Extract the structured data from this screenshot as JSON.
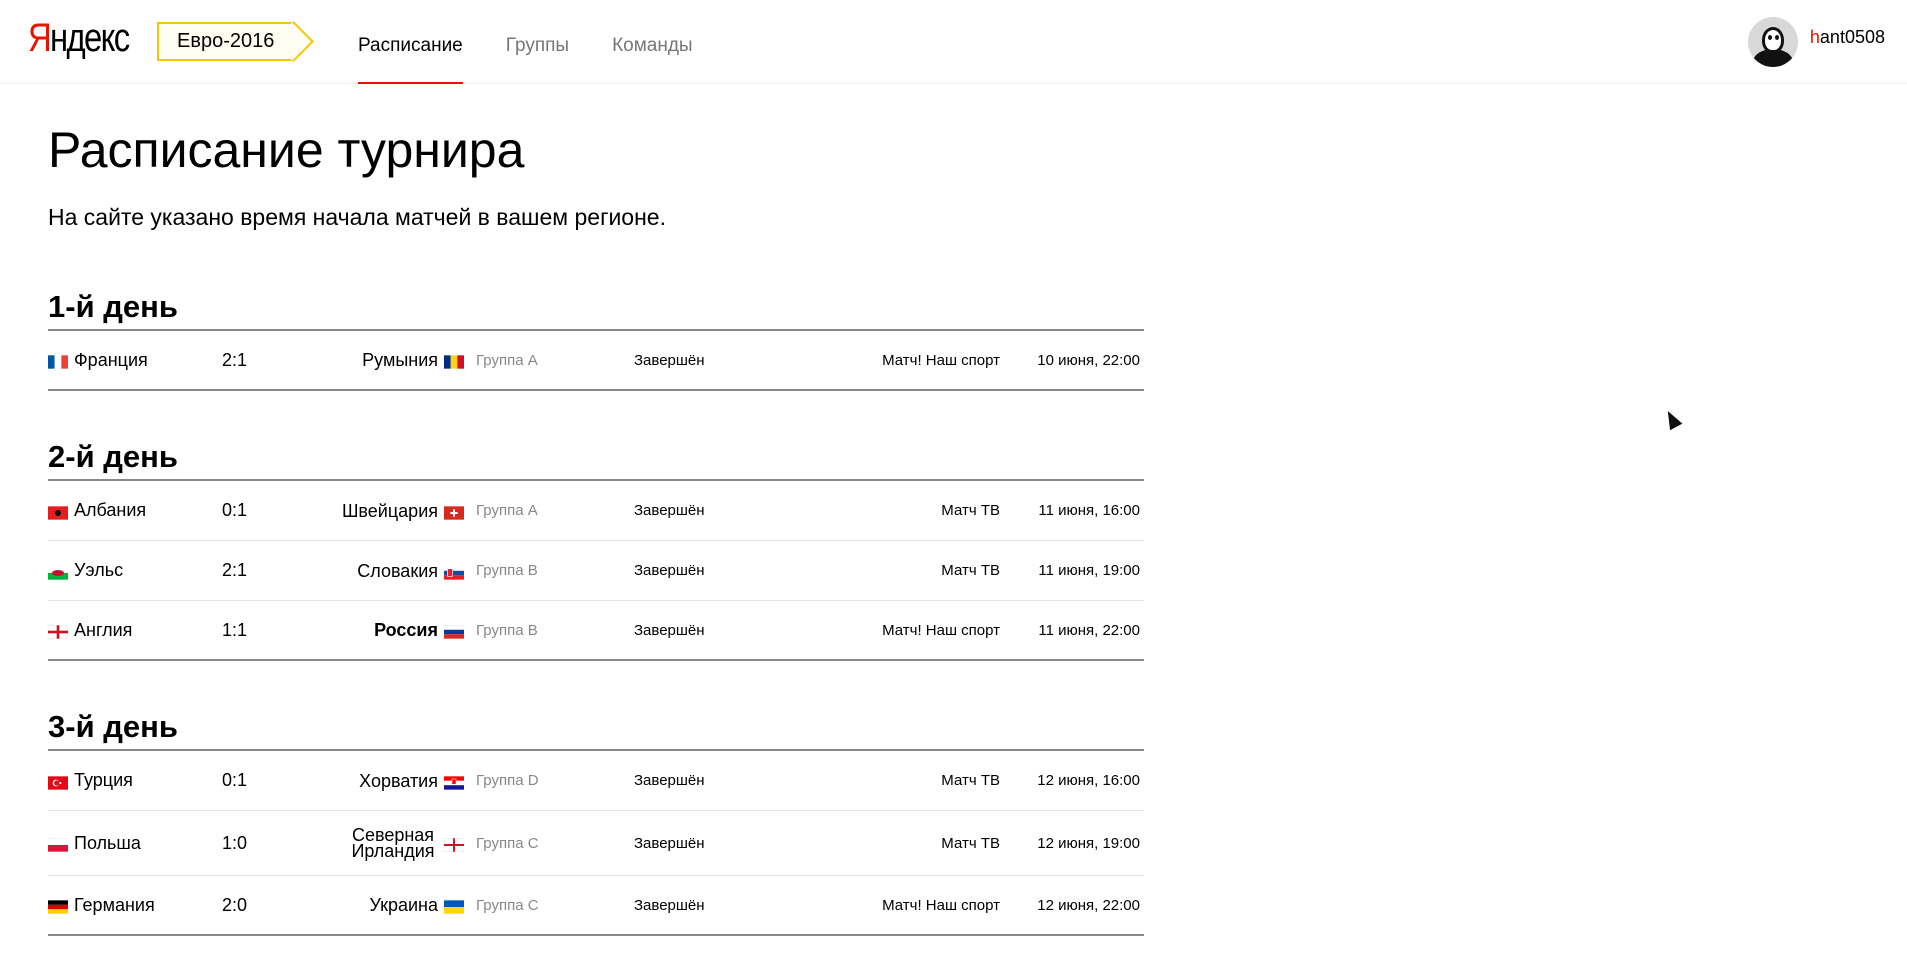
{
  "header": {
    "logo": {
      "first": "Я",
      "rest": "ндекс"
    },
    "tag": "Евро-2016",
    "nav": [
      {
        "label": "Расписание",
        "active": true
      },
      {
        "label": "Группы",
        "active": false
      },
      {
        "label": "Команды",
        "active": false
      }
    ],
    "user": {
      "first_letter": "h",
      "rest": "ant0508"
    }
  },
  "page": {
    "title": "Расписание турнира",
    "subtitle": "На сайте указано время начала матчей в вашем регионе."
  },
  "days": [
    {
      "title": "1-й день",
      "matches": [
        {
          "team1": "Франция",
          "flag1": "france-flag-icon",
          "score": "2:1",
          "team2": "Румыния",
          "flag2": "romania-flag-icon",
          "group": "Группа A",
          "status": "Завершён",
          "channel": "Матч! Наш спорт",
          "when": "10 июня, 22:00"
        }
      ]
    },
    {
      "title": "2-й день",
      "matches": [
        {
          "team1": "Албания",
          "flag1": "albania-flag-icon",
          "score": "0:1",
          "team2": "Швейцария",
          "flag2": "switzerland-flag-icon",
          "group": "Группа A",
          "status": "Завершён",
          "channel": "Матч ТВ",
          "when": "11 июня, 16:00"
        },
        {
          "team1": "Уэльс",
          "flag1": "wales-flag-icon",
          "score": "2:1",
          "team2": "Словакия",
          "flag2": "slovakia-flag-icon",
          "group": "Группа B",
          "status": "Завершён",
          "channel": "Матч ТВ",
          "when": "11 июня, 19:00"
        },
        {
          "team1": "Англия",
          "flag1": "england-flag-icon",
          "score": "1:1",
          "team2": "Россия",
          "flag2": "russia-flag-icon",
          "group": "Группа B",
          "status": "Завершён",
          "channel": "Матч! Наш спорт",
          "when": "11 июня, 22:00"
        }
      ]
    },
    {
      "title": "3-й день",
      "matches": [
        {
          "team1": "Турция",
          "flag1": "turkey-flag-icon",
          "score": "0:1",
          "team2": "Хорватия",
          "flag2": "croatia-flag-icon",
          "group": "Группа D",
          "status": "Завершён",
          "channel": "Матч ТВ",
          "when": "12 июня, 16:00"
        },
        {
          "team1": "Польша",
          "flag1": "poland-flag-icon",
          "score": "1:0",
          "team2": "Северная Ирландия",
          "flag2": "northern-ireland-flag-icon",
          "group": "Группа C",
          "status": "Завершён",
          "channel": "Матч ТВ",
          "when": "12 июня, 19:00"
        },
        {
          "team1": "Германия",
          "flag1": "germany-flag-icon",
          "score": "2:0",
          "team2": "Украина",
          "flag2": "ukraine-flag-icon",
          "group": "Группа C",
          "status": "Завершён",
          "channel": "Матч! Наш спорт",
          "when": "12 июня, 22:00"
        }
      ]
    }
  ]
}
